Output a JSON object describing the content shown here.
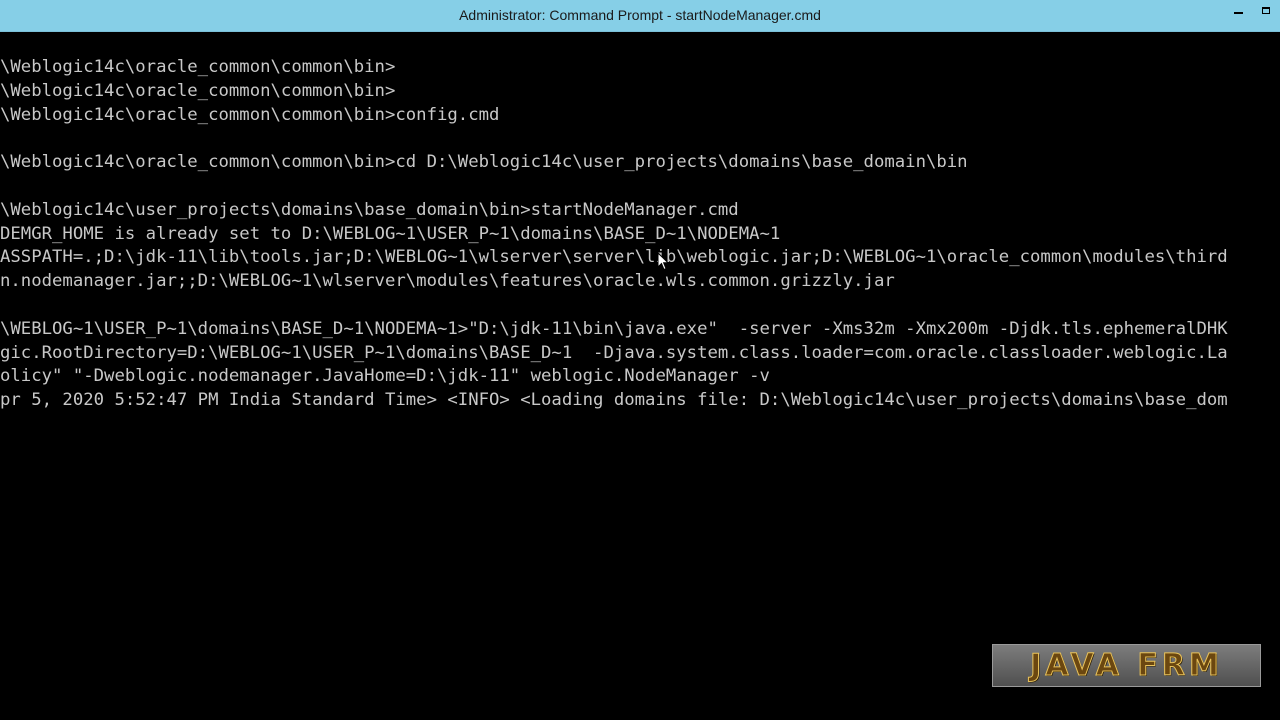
{
  "window": {
    "title": "Administrator: Command Prompt - startNodeManager.cmd"
  },
  "console": {
    "lines": [
      "\\Weblogic14c\\oracle_common\\common\\bin>",
      "\\Weblogic14c\\oracle_common\\common\\bin>",
      "\\Weblogic14c\\oracle_common\\common\\bin>config.cmd",
      "",
      "\\Weblogic14c\\oracle_common\\common\\bin>cd D:\\Weblogic14c\\user_projects\\domains\\base_domain\\bin",
      "",
      "\\Weblogic14c\\user_projects\\domains\\base_domain\\bin>startNodeManager.cmd",
      "DEMGR_HOME is already set to D:\\WEBLOG~1\\USER_P~1\\domains\\BASE_D~1\\NODEMA~1",
      "ASSPATH=.;D:\\jdk-11\\lib\\tools.jar;D:\\WEBLOG~1\\wlserver\\server\\lib\\weblogic.jar;D:\\WEBLOG~1\\oracle_common\\modules\\third",
      "n.nodemanager.jar;;D:\\WEBLOG~1\\wlserver\\modules\\features\\oracle.wls.common.grizzly.jar",
      "",
      "\\WEBLOG~1\\USER_P~1\\domains\\BASE_D~1\\NODEMA~1>\"D:\\jdk-11\\bin\\java.exe\"  -server -Xms32m -Xmx200m -Djdk.tls.ephemeralDHK",
      "gic.RootDirectory=D:\\WEBLOG~1\\USER_P~1\\domains\\BASE_D~1  -Djava.system.class.loader=com.oracle.classloader.weblogic.La",
      "olicy\" \"-Dweblogic.nodemanager.JavaHome=D:\\jdk-11\" weblogic.NodeManager -v",
      "pr 5, 2020 5:52:47 PM India Standard Time> <INFO> <Loading domains file: D:\\Weblogic14c\\user_projects\\domains\\base_dom"
    ]
  },
  "watermark": {
    "text": "JAVA FRM"
  },
  "icons": {
    "minimize": "minimize-icon",
    "maximize": "maximize-icon",
    "cursor": "mouse-pointer-icon"
  },
  "colors": {
    "titlebar": "#86cfe7",
    "console_bg": "#000000",
    "console_text": "#c8c8c8"
  }
}
